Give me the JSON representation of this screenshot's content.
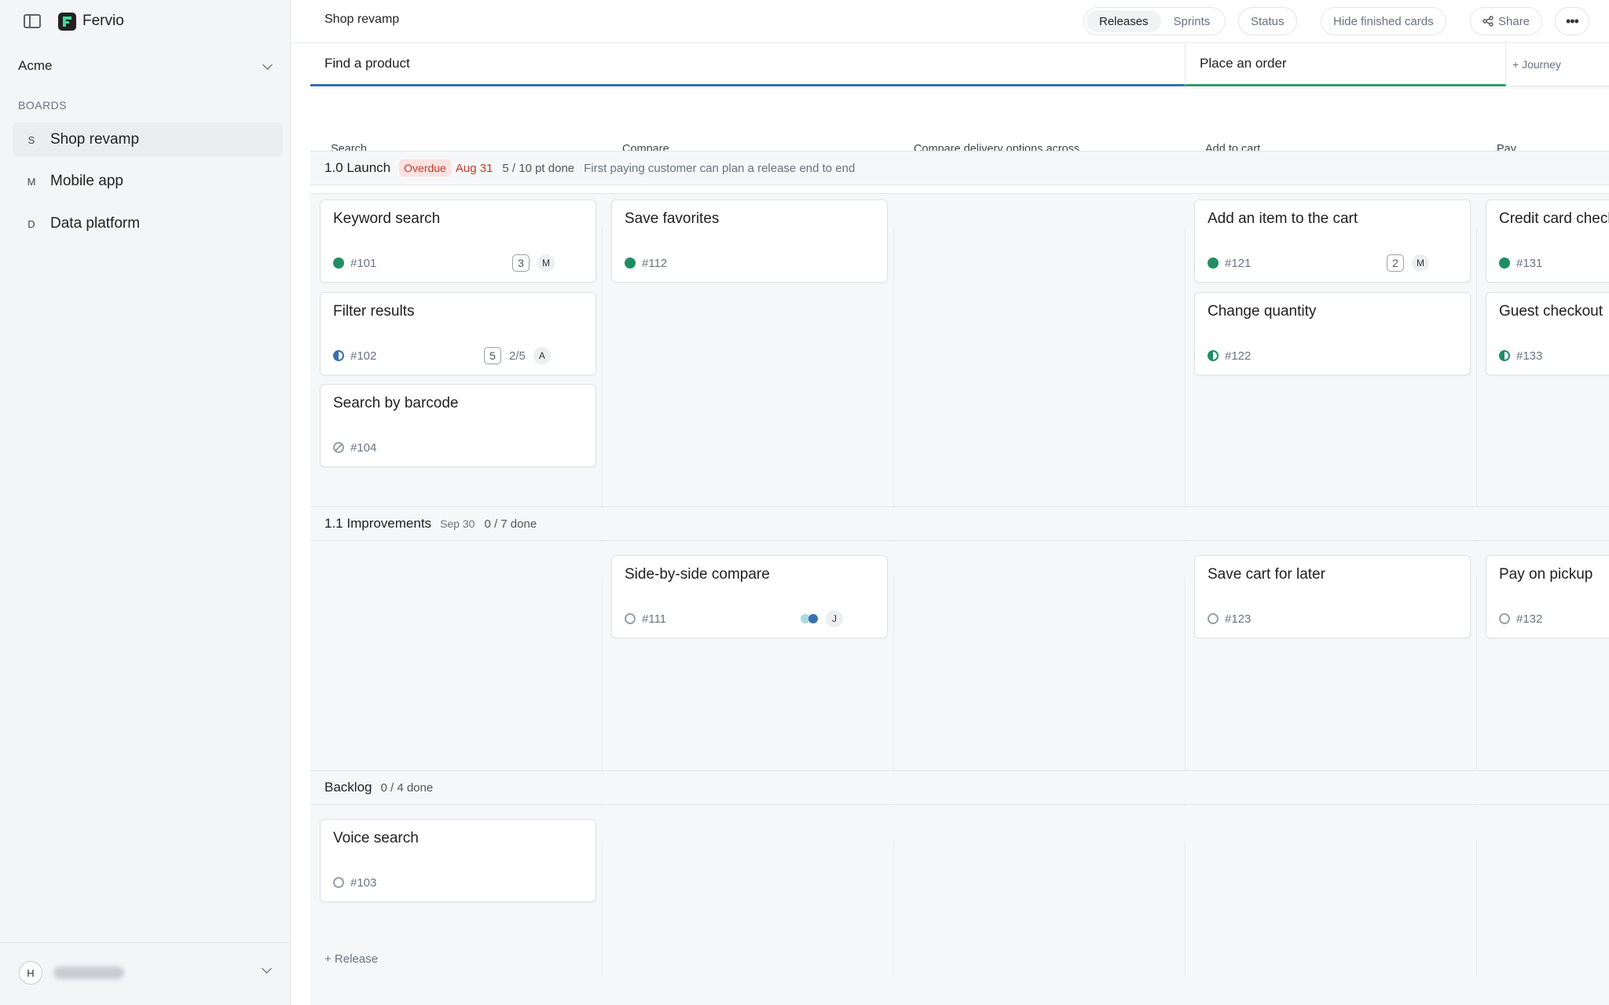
{
  "app": {
    "name": "Fervio"
  },
  "sidebar": {
    "workspace": "Acme",
    "boards_label": "BOARDS",
    "boards": [
      {
        "initial": "S",
        "name": "Shop revamp",
        "active": true
      },
      {
        "initial": "M",
        "name": "Mobile app",
        "active": false
      },
      {
        "initial": "D",
        "name": "Data platform",
        "active": false
      }
    ],
    "user_initial": "H"
  },
  "topbar": {
    "title": "Shop revamp",
    "views": [
      "Releases",
      "Sprints"
    ],
    "active_view": "Releases",
    "status_label": "Status",
    "hide_finished_label": "Hide finished cards",
    "share_label": "Share",
    "more_label": "•••"
  },
  "journeys": [
    {
      "name": "Place an order"
    },
    {
      "name": "Find a product"
    }
  ],
  "journey_list": [
    "Find a product",
    "Place an order"
  ],
  "add_journey_label": "+ Journey",
  "steps": [
    "Search",
    "Compare",
    "Compare delivery options across warehouses",
    "Add to cart",
    "Pay"
  ],
  "releases": [
    {
      "name": "1.0 Launch",
      "overdue_label": "Overdue",
      "date": "Aug 31",
      "progress": "5 / 10 pt done",
      "description": "First paying customer can plan a release end to end",
      "cards": [
        {
          "title": "Keyword search",
          "id": "#101",
          "status": "done",
          "points": "3",
          "assignee": "M"
        },
        {
          "title": "Filter results",
          "id": "#102",
          "status": "in-progress",
          "points": "5",
          "subtasks": "2/5",
          "assignee": "A"
        },
        {
          "title": "Search by barcode",
          "id": "#104",
          "status": "cancelled"
        },
        {
          "title": "Save favorites",
          "id": "#112",
          "status": "done"
        },
        {
          "title": "Add an item to the cart",
          "id": "#121",
          "status": "done",
          "points": "2",
          "assignee": "M"
        },
        {
          "title": "Change quantity",
          "id": "#122",
          "status": "in-progress"
        },
        {
          "title": "Credit card checkout",
          "id": "#131",
          "status": "done"
        },
        {
          "title": "Guest checkout",
          "id": "#133",
          "status": "in-progress"
        }
      ]
    },
    {
      "name": "1.1 Improvements",
      "date": "Sep 30",
      "progress": "0 / 7 done",
      "cards": [
        {
          "title": "Side-by-side compare",
          "id": "#111",
          "status": "todo",
          "assignee": "J"
        },
        {
          "title": "Save cart for later",
          "id": "#123",
          "status": "todo"
        },
        {
          "title": "Pay on pickup",
          "id": "#132",
          "status": "todo"
        }
      ]
    },
    {
      "name": "Backlog",
      "progress": "0 / 4 done",
      "cards": [
        {
          "title": "Voice search",
          "id": "#103",
          "status": "todo"
        }
      ]
    }
  ],
  "add_release_label": "+ Release",
  "colors": {
    "journey_find": "#3a6fb0",
    "journey_order": "#2e9d6b",
    "status_done": "#1f8e64",
    "overdue": "#c0392b"
  }
}
